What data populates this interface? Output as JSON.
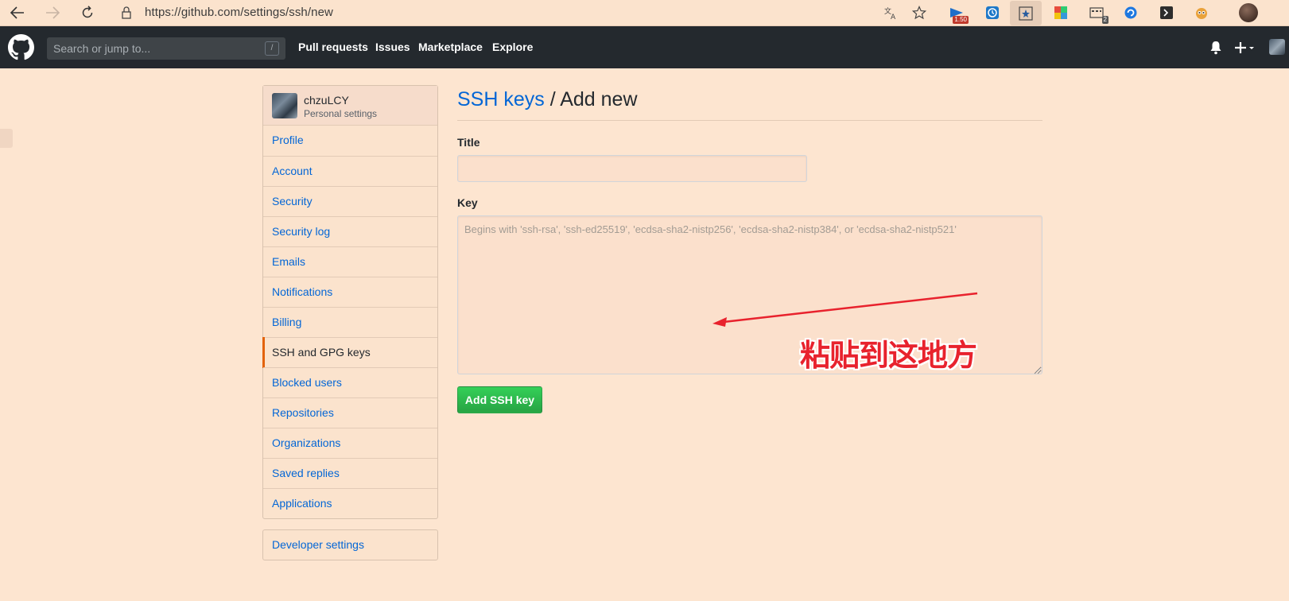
{
  "browser": {
    "url": "https://github.com/settings/ssh/new",
    "ext_badge_1": "1.50",
    "ext_badge_2": "2"
  },
  "header": {
    "search_placeholder": "Search or jump to...",
    "search_key": "/",
    "nav": [
      "Pull requests",
      "Issues",
      "Marketplace",
      "Explore"
    ]
  },
  "sidebar": {
    "username": "chzuLCY",
    "subtitle": "Personal settings",
    "items": [
      {
        "label": "Profile"
      },
      {
        "label": "Account"
      },
      {
        "label": "Security"
      },
      {
        "label": "Security log"
      },
      {
        "label": "Emails"
      },
      {
        "label": "Notifications"
      },
      {
        "label": "Billing"
      },
      {
        "label": "SSH and GPG keys",
        "active": true
      },
      {
        "label": "Blocked users"
      },
      {
        "label": "Repositories"
      },
      {
        "label": "Organizations"
      },
      {
        "label": "Saved replies"
      },
      {
        "label": "Applications"
      }
    ],
    "developer_settings": "Developer settings"
  },
  "main": {
    "title_link": "SSH keys",
    "title_rest": " / Add new",
    "title_label": "Title",
    "key_label": "Key",
    "key_placeholder": "Begins with 'ssh-rsa', 'ssh-ed25519', 'ecdsa-sha2-nistp256', 'ecdsa-sha2-nistp384', or 'ecdsa-sha2-nistp521'",
    "submit": "Add SSH key"
  },
  "annotation": {
    "text": "粘贴到这地方",
    "color": "#e8222d"
  },
  "colors": {
    "accent_link": "#0366d6",
    "header_bg": "#24292e",
    "button_green": "#28a745",
    "active_marker": "#e36209",
    "page_bg": "#fde5d0"
  }
}
